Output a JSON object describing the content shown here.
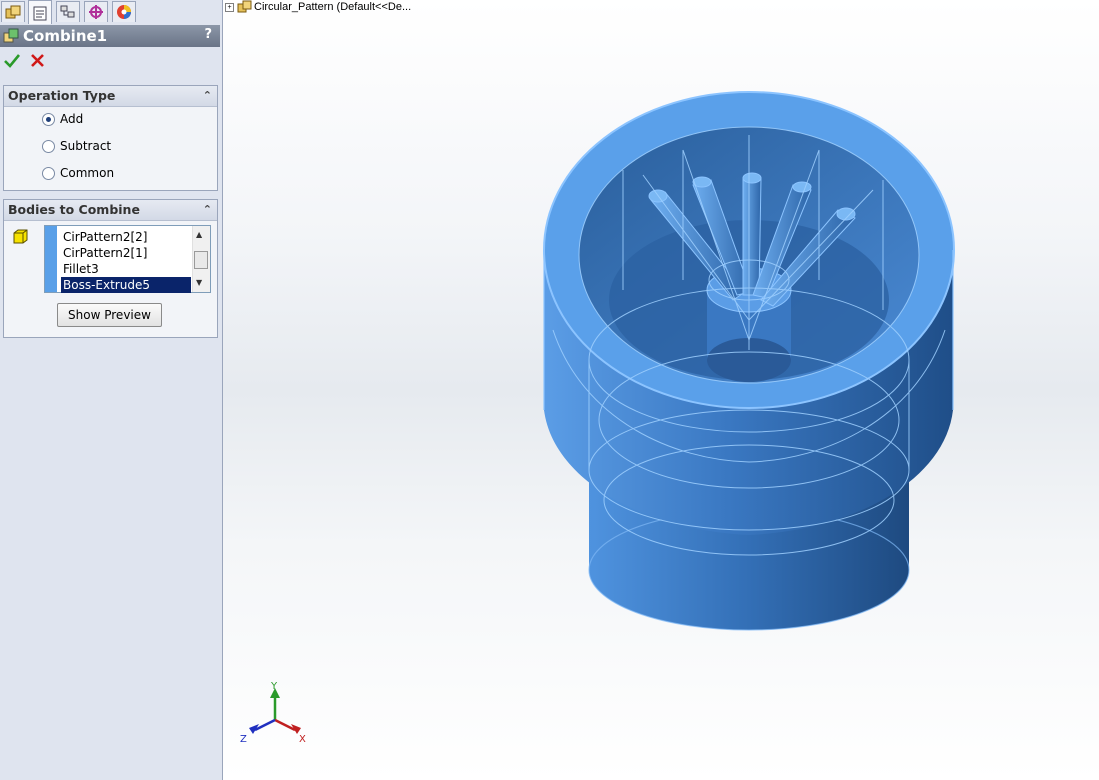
{
  "feature_title": "Combine1",
  "help_label": "?",
  "sections": {
    "operation_type": {
      "header": "Operation Type",
      "options": [
        "Add",
        "Subtract",
        "Common"
      ],
      "selected": "Add"
    },
    "bodies_to_combine": {
      "header": "Bodies to Combine",
      "items": [
        "CirPattern2[2]",
        "CirPattern2[1]",
        "Fillet3",
        "Boss-Extrude5"
      ],
      "selected_item": "Boss-Extrude5",
      "show_preview_label": "Show Preview"
    }
  },
  "viewport": {
    "tree_label": "Circular_Pattern  (Default<<De...",
    "axes": {
      "x": "X",
      "y": "Y",
      "z": "Z"
    }
  },
  "colors": {
    "model_blue": "#3d84d6",
    "selection_navy": "#0a246a",
    "title_bar": "#7a8496"
  },
  "icons": [
    "feature-manager-icon",
    "property-manager-icon",
    "configuration-manager-icon",
    "dimxpert-icon",
    "display-manager-icon",
    "combine-feature-icon",
    "ok-check-icon",
    "cancel-x-icon",
    "solid-body-icon",
    "assembly-tree-icon"
  ]
}
